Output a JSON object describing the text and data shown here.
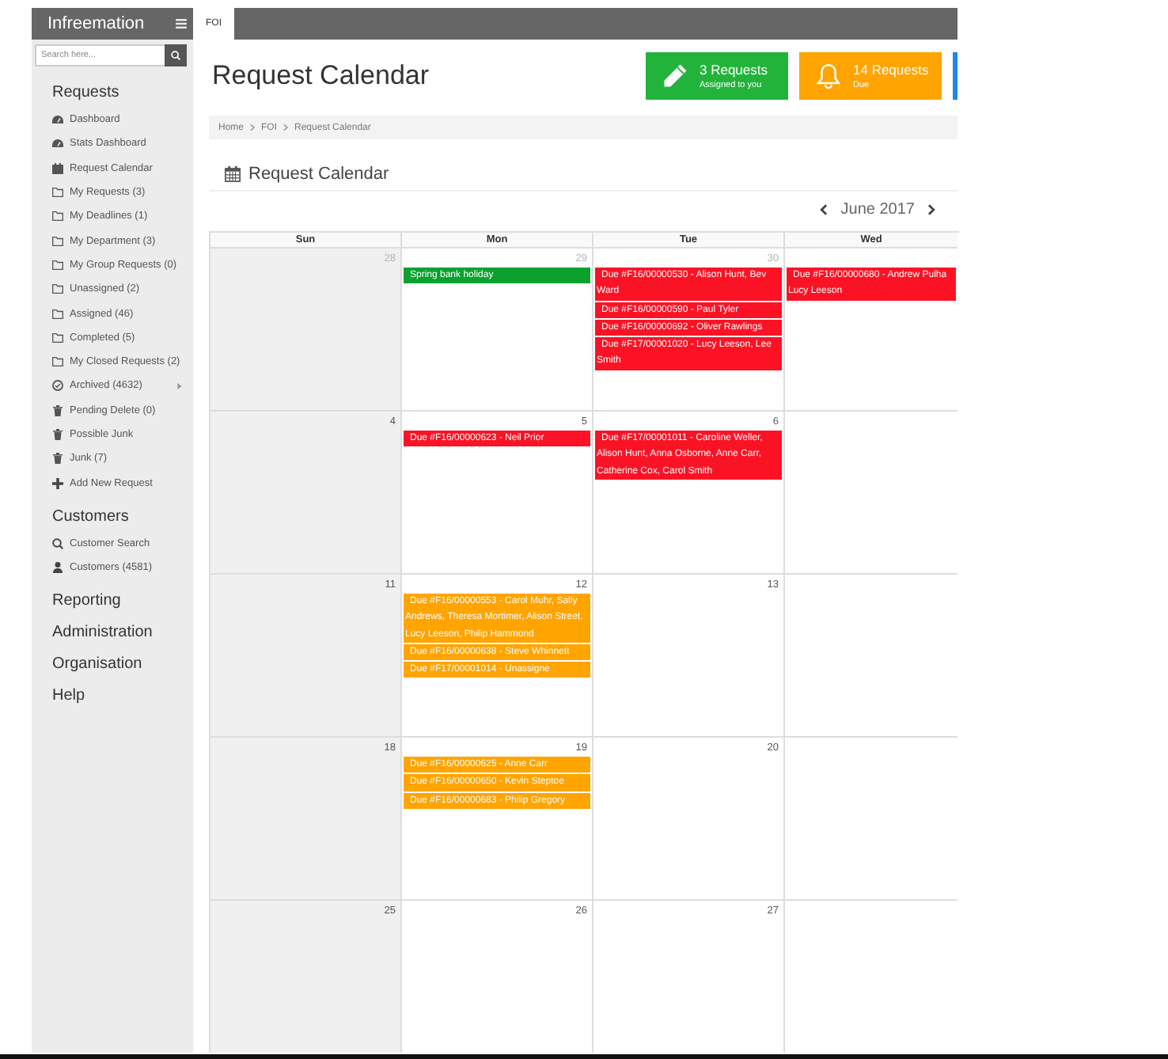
{
  "sidebar": {
    "title": "Infreemation",
    "search": {
      "placeholder": "Search here..."
    },
    "sections": [
      {
        "heading": "Requests",
        "items": [
          {
            "label": "Dashboard",
            "kind": "dashboard",
            "submenu": false
          },
          {
            "label": "Stats Dashboard",
            "kind": "dashboard",
            "submenu": false
          },
          {
            "label": "Request Calendar",
            "kind": "calendar",
            "submenu": false
          },
          {
            "label": "My Requests (3)",
            "kind": "folder",
            "submenu": false
          },
          {
            "label": "My Deadlines (1)",
            "kind": "folder",
            "submenu": false
          },
          {
            "label": "My Department (3)",
            "kind": "folder",
            "submenu": false
          },
          {
            "label": "My Group Requests (0)",
            "kind": "folder",
            "submenu": false
          },
          {
            "label": "Unassigned (2)",
            "kind": "folder",
            "submenu": false
          },
          {
            "label": "Assigned (46)",
            "kind": "folder",
            "submenu": false
          },
          {
            "label": "Completed (5)",
            "kind": "folder",
            "submenu": false
          },
          {
            "label": "My Closed Requests (2)",
            "kind": "folder",
            "submenu": false
          },
          {
            "label": "Archived (4632)",
            "kind": "archive",
            "submenu": true
          },
          {
            "label": "Pending Delete (0)",
            "kind": "bin",
            "submenu": false
          },
          {
            "label": "Possible Junk",
            "kind": "bin",
            "submenu": false
          },
          {
            "label": "Junk (7)",
            "kind": "bin",
            "submenu": false
          },
          {
            "label": "Add New Request",
            "kind": "add",
            "submenu": false
          }
        ]
      },
      {
        "heading": "Customers",
        "items": [
          {
            "label": "Customer Search",
            "kind": "search",
            "submenu": false
          },
          {
            "label": "Customers (4581)",
            "kind": "contacts",
            "submenu": false
          }
        ]
      },
      {
        "heading": "Reporting"
      },
      {
        "heading": "Administration"
      },
      {
        "heading": "Organisation"
      },
      {
        "heading": "Help"
      }
    ]
  },
  "tabs": [
    {
      "label": "FOI",
      "selected": true
    }
  ],
  "header": {
    "title": "Request Calendar",
    "stats": [
      {
        "kind": "assigned",
        "count": "3 Requests",
        "caption": "Assigned to you",
        "color": "#22b43a"
      },
      {
        "kind": "due",
        "count": "14 Requests",
        "caption": "Due",
        "color": "#ffa400"
      },
      {
        "kind": "other",
        "color": "#1e88e5"
      }
    ]
  },
  "breadcrumb": [
    "Home",
    "FOI",
    "Request Calendar"
  ],
  "calendar": {
    "title": "Request Calendar",
    "month": "June 2017",
    "columns": [
      {
        "label": "Sun",
        "weekend": true
      },
      {
        "label": "Mon",
        "weekend": false
      },
      {
        "label": "Tue",
        "weekend": false
      },
      {
        "label": "Wed",
        "weekend": false
      }
    ],
    "weeks": [
      {
        "days": [
          {
            "date": "28",
            "other_month": true
          },
          {
            "date": "29",
            "other_month": true,
            "events": [
              {
                "text": "Spring bank holiday",
                "color": "#0aa12f"
              }
            ]
          },
          {
            "date": "30",
            "other_month": true,
            "events": [
              {
                "text": "Due #F16/00000530 - Alison Hunt, Bev Ward",
                "color": "#fb1325"
              },
              {
                "text": "Due #F16/00000590 - Paul Tyler",
                "color": "#fb1325"
              },
              {
                "text": "Due #F16/00000692 - Oliver Rawlings",
                "color": "#fb1325"
              },
              {
                "text": "Due #F17/00001020 - Lucy Leeson, Lee Smith",
                "color": "#fb1325"
              }
            ]
          },
          {
            "events": [
              {
                "text": "Due #F16/00000680 - Andrew Pulha\nLucy Leeson",
                "color": "#fb1325"
              }
            ]
          }
        ]
      },
      {
        "days": [
          {
            "date": "4",
            "other_month": false
          },
          {
            "date": "5",
            "other_month": false,
            "events": [
              {
                "text": "Due #F16/00000623 - Neil Prior",
                "color": "#fb1325"
              }
            ]
          },
          {
            "date": "6",
            "other_month": false,
            "events": [
              {
                "text": "Due #F17/00001011 - Caroline Weller, Alison Hunt, Anna Osborne, Anne Carr, Catherine Cox, Carol Smith",
                "color": "#fb1325"
              }
            ]
          }
        ]
      },
      {
        "days": [
          {
            "date": "11",
            "other_month": false
          },
          {
            "date": "12",
            "other_month": false,
            "events": [
              {
                "text": "Due #F16/00000553 - Carol Muhr, Sally Andrews, Theresa Mortimer, Alison Street, Lucy Leeson, Philip Hammond",
                "color": "#ffa400"
              },
              {
                "text": "Due #F16/00000638 - Steve Whinnett",
                "color": "#ffa400"
              },
              {
                "text": "Due #F17/00001014 - Unassigne",
                "color": "#ffa400"
              }
            ]
          },
          {
            "date": "13",
            "other_month": false
          }
        ]
      },
      {
        "days": [
          {
            "date": "18",
            "other_month": false
          },
          {
            "date": "19",
            "other_month": false,
            "events": [
              {
                "text": "Due #F16/00000625 - Anne Carr",
                "color": "#ffa400"
              },
              {
                "text": "Due #F16/00000650 - Kevin Steptoe",
                "color": "#ffa400"
              },
              {
                "text": "Due #F16/00000683 - Philip Gregory",
                "color": "#ffa400"
              }
            ]
          },
          {
            "date": "20",
            "other_month": false
          }
        ]
      },
      {
        "days": [
          {
            "date": "25",
            "other_month": false
          },
          {
            "date": "26",
            "other_month": false
          },
          {
            "date": "27",
            "other_month": false
          }
        ]
      }
    ]
  }
}
